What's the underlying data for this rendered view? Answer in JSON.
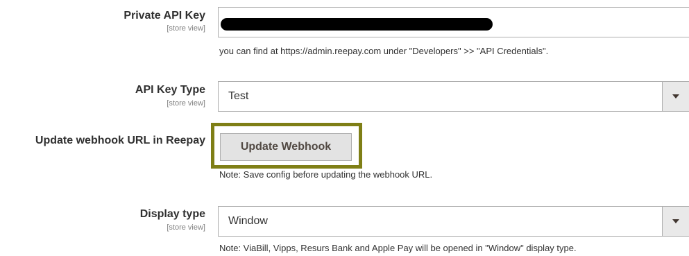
{
  "private_api_key": {
    "label": "Private API Key",
    "scope": "[store view]",
    "value": "",
    "note": "you can find at https://admin.reepay.com under \"Developers\" >> \"API Credentials\"."
  },
  "api_key_type": {
    "label": "API Key Type",
    "scope": "[store view]",
    "selected": "Test"
  },
  "webhook": {
    "label": "Update webhook URL in Reepay",
    "button_label": "Update Webhook",
    "note": "Note: Save config before updating the webhook URL.",
    "highlight_color": "#7f7f16"
  },
  "display_type": {
    "label": "Display type",
    "scope": "[store view]",
    "selected": "Window",
    "note": "Note: ViaBill, Vipps, Resurs Bank and Apple Pay will be opened in \"Window\" display type."
  }
}
